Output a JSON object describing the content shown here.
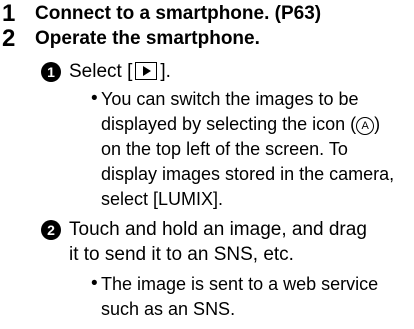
{
  "steps": [
    {
      "number": "1",
      "text": "Connect to a smartphone. (P63)"
    },
    {
      "number": "2",
      "text": "Operate the smartphone."
    }
  ],
  "substeps": [
    {
      "marker": "1",
      "text_before_icon": "Select [",
      "icon": "playback-icon",
      "text_after_icon": "].",
      "bullet": {
        "line1": "You can switch the images to be",
        "line2_before": "displayed by selecting the icon (",
        "callout_letter": "A",
        "line2_after": ")",
        "line3": "on the top left of the screen. To",
        "line4": "display images stored in the camera,",
        "line5": "select [LUMIX]."
      }
    },
    {
      "marker": "2",
      "line1": "Touch and hold an image, and drag",
      "line2": "it to send it to an SNS, etc.",
      "bullet": {
        "line1": "The image is sent to a web service",
        "line2": "such as an SNS."
      }
    }
  ]
}
